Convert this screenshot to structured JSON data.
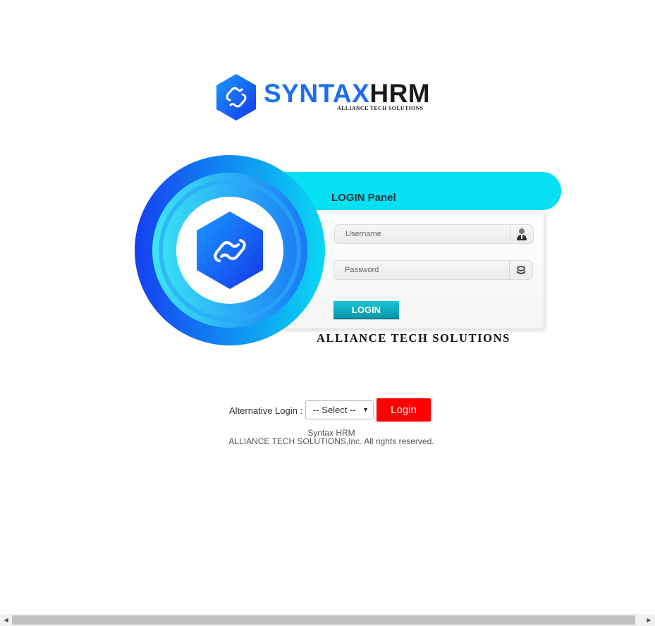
{
  "brand": {
    "name_part1": "SYNTAX",
    "name_part2": "HRM",
    "subtitle": "ALLIANCE TECH SOLUTIONS"
  },
  "panel": {
    "title": "LOGIN Panel",
    "username_placeholder": "Username",
    "password_placeholder": "Password",
    "login_label": "LOGIN",
    "company_caption": "ALLIANCE TECH SOLUTIONS"
  },
  "alternative": {
    "label": "Alternative Login :",
    "select_value": "-- Select --",
    "login_label": "Login"
  },
  "footer": {
    "line1": "Syntax HRM",
    "line2": "ALLIANCE TECH SOLUTIONS,Inc. All rights reserved."
  },
  "colors": {
    "brand_blue": "#1e6ff0",
    "panel_cyan": "#05e0f2",
    "login_teal": "#0fa9bd",
    "alt_login_red": "#ff0000"
  },
  "icons": {
    "logo": "syntax-hex-logo",
    "user": "user-icon",
    "password": "password-icon"
  }
}
